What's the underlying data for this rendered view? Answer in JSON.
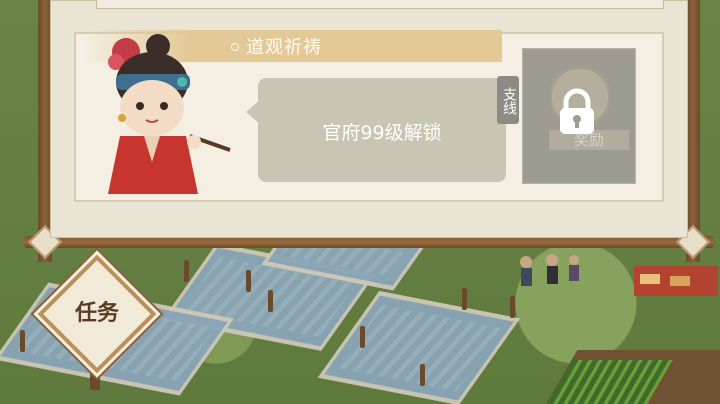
{
  "quest": {
    "title": "道观祈祷",
    "unlock_message": "官府99级解锁",
    "tag": "支线",
    "reward_label": "奖励",
    "locked": true
  },
  "task_button": {
    "label": "任务"
  },
  "icons": [
    "lock-icon",
    "coin-icon",
    "character-portrait",
    "title-dot-icon"
  ],
  "colors": {
    "panel_bg": "#e9e4d3",
    "banner": "#e3c996",
    "bubble": "#c8c5b3",
    "frame_wood": "#8b6238"
  }
}
